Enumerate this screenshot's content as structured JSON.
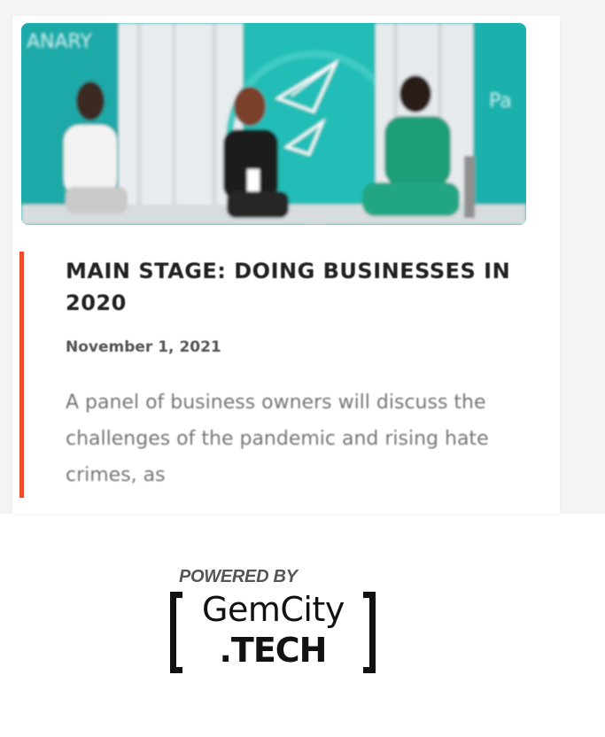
{
  "article": {
    "image_alt": "Panel of three speakers on stage",
    "banner_text_left": "ANARY",
    "banner_text_right": "Pa",
    "title": "MAIN STAGE: DOING BUSINESSES IN 2020",
    "date": "November 1, 2021",
    "excerpt": "A panel of business owners will discuss the challenges of the pandemic and rising hate crimes, as"
  },
  "footer": {
    "powered_by": "POWERED BY",
    "logo_line1": "GemCity",
    "logo_line2": ".TECH"
  },
  "colors": {
    "accent": "#f04e2b",
    "teal": "#1fb3b0",
    "text_dark": "#222222",
    "text_muted": "#777777"
  }
}
